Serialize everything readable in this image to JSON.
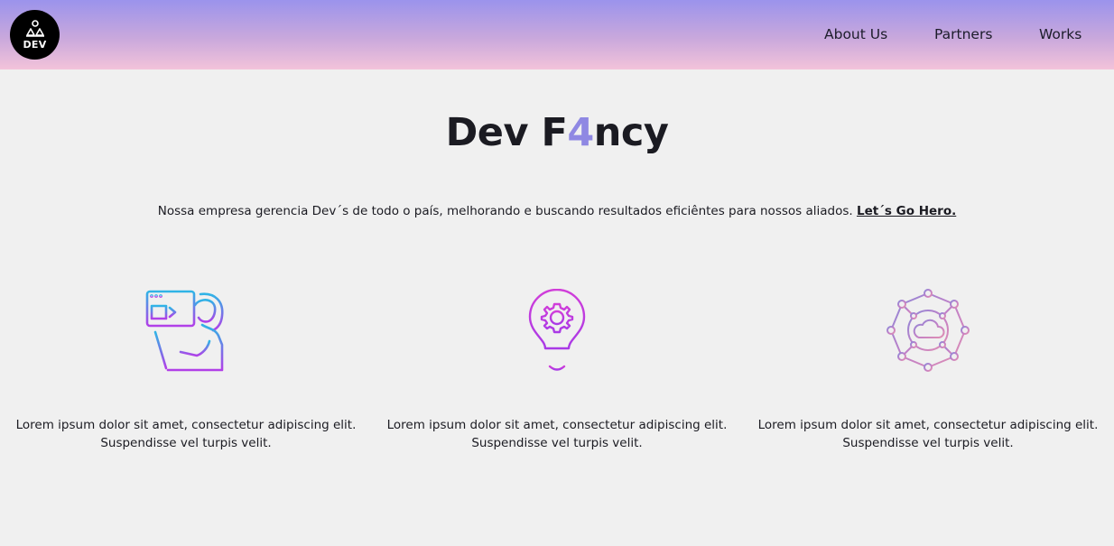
{
  "header": {
    "logo_text": "DEV",
    "nav": [
      {
        "label": "About Us"
      },
      {
        "label": "Partners"
      },
      {
        "label": "Works"
      }
    ]
  },
  "hero": {
    "title_part1": "Dev F",
    "title_accent": "4",
    "title_part2": "ncy",
    "description": "Nossa empresa gerencia Dev´s de todo o país, melhorando e buscando resultados eficiêntes para nossos aliados.",
    "cta_link": "Let´s Go Hero."
  },
  "features": [
    {
      "icon": "developer-at-computer-icon",
      "line1": "Lorem ipsum dolor sit amet, consectetur adipiscing elit.",
      "line2": "Suspendisse vel turpis velit."
    },
    {
      "icon": "lightbulb-gear-icon",
      "line1": "Lorem ipsum dolor sit amet, consectetur adipiscing elit.",
      "line2": "Suspendisse vel turpis velit."
    },
    {
      "icon": "cloud-network-icon",
      "line1": "Lorem ipsum dolor sit amet, consectetur adipiscing elit.",
      "line2": "Suspendisse vel turpis velit."
    }
  ],
  "colors": {
    "accent": "#8f88e3",
    "header_gradient_top": "#9b93ec",
    "header_gradient_bottom": "#f3c3da",
    "background": "#f0f0f0"
  }
}
